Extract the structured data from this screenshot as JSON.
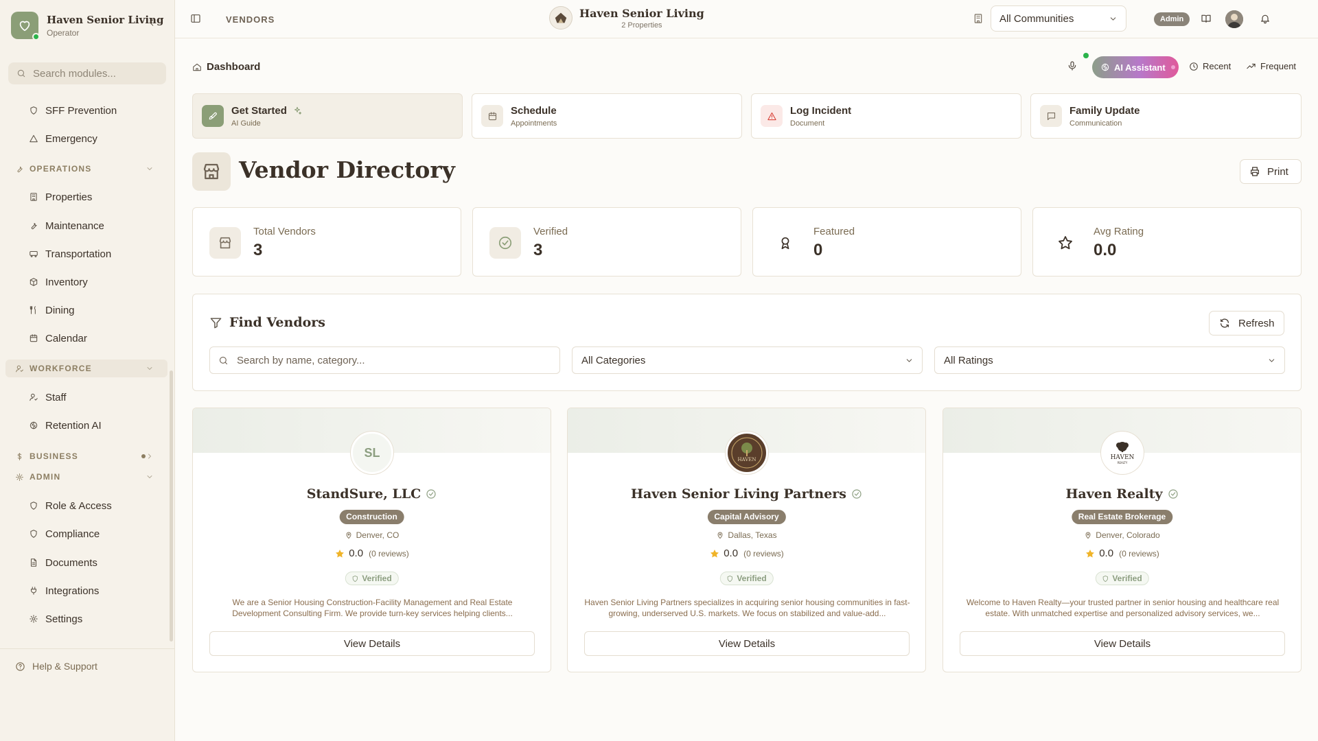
{
  "sidebar": {
    "brand_name": "Haven Senior Living",
    "brand_role": "Operator",
    "search_placeholder": "Search modules...",
    "items_top": [
      {
        "label": "SFF Prevention",
        "icon": "shield-icon"
      },
      {
        "label": "Emergency",
        "icon": "alert-triangle-icon"
      }
    ],
    "sections": {
      "operations": "OPERATIONS",
      "workforce": "WORKFORCE",
      "business": "BUSINESS",
      "admin": "ADMIN"
    },
    "operations_items": [
      "Properties",
      "Maintenance",
      "Transportation",
      "Inventory",
      "Dining",
      "Calendar"
    ],
    "workforce_items": [
      "Staff",
      "Retention AI"
    ],
    "admin_items": [
      "Role & Access",
      "Compliance",
      "Documents",
      "Integrations",
      "Settings"
    ],
    "help": "Help & Support"
  },
  "topbar": {
    "breadcrumb": "VENDORS",
    "org_name": "Haven Senior Living",
    "org_sub": "2 Properties",
    "community_select": "All Communities",
    "admin_badge": "Admin"
  },
  "toolbar": {
    "dashboard": "Dashboard",
    "ai_assistant": "AI Assistant",
    "recent": "Recent",
    "frequent": "Frequent"
  },
  "quick_actions": [
    {
      "title": "Get Started",
      "subtitle": "AI Guide"
    },
    {
      "title": "Schedule",
      "subtitle": "Appointments"
    },
    {
      "title": "Log Incident",
      "subtitle": "Document"
    },
    {
      "title": "Family Update",
      "subtitle": "Communication"
    }
  ],
  "page": {
    "title": "Vendor Directory",
    "print": "Print"
  },
  "stats": [
    {
      "label": "Total Vendors",
      "value": "3"
    },
    {
      "label": "Verified",
      "value": "3"
    },
    {
      "label": "Featured",
      "value": "0"
    },
    {
      "label": "Avg Rating",
      "value": "0.0"
    }
  ],
  "filters": {
    "title": "Find Vendors",
    "refresh": "Refresh",
    "search_placeholder": "Search by name, category...",
    "category": "All Categories",
    "rating": "All Ratings"
  },
  "vendors": [
    {
      "initials": "SL",
      "name": "StandSure, LLC",
      "category": "Construction",
      "location": "Denver, CO",
      "rating": "0.0",
      "reviews": "(0 reviews)",
      "verified": "Verified",
      "description": "We are a Senior Housing Construction-Facility Management and Real Estate Development Consulting Firm. We provide turn-key services helping clients...",
      "button": "View Details"
    },
    {
      "name": "Haven Senior Living Partners",
      "logo_text": "HAVEN",
      "category": "Capital Advisory",
      "location": "Dallas, Texas",
      "rating": "0.0",
      "reviews": "(0 reviews)",
      "verified": "Verified",
      "description": "Haven Senior Living Partners specializes in acquiring senior housing communities in fast-growing, underserved U.S. markets. We focus on stabilized and value-add...",
      "button": "View Details"
    },
    {
      "name": "Haven Realty",
      "logo_text": "HAVEN",
      "logo_sub": "REALTY",
      "category": "Real Estate Brokerage",
      "location": "Denver, Colorado",
      "rating": "0.0",
      "reviews": "(0 reviews)",
      "verified": "Verified",
      "description": "Welcome to Haven Realty—your trusted partner in senior housing and healthcare real estate. With unmatched expertise and personalized advisory services, we...",
      "button": "View Details"
    }
  ],
  "colors": {
    "accent": "#8b9e77",
    "badge": "#8a7e6c",
    "text": "#3b3128",
    "star": "#f0b429"
  }
}
